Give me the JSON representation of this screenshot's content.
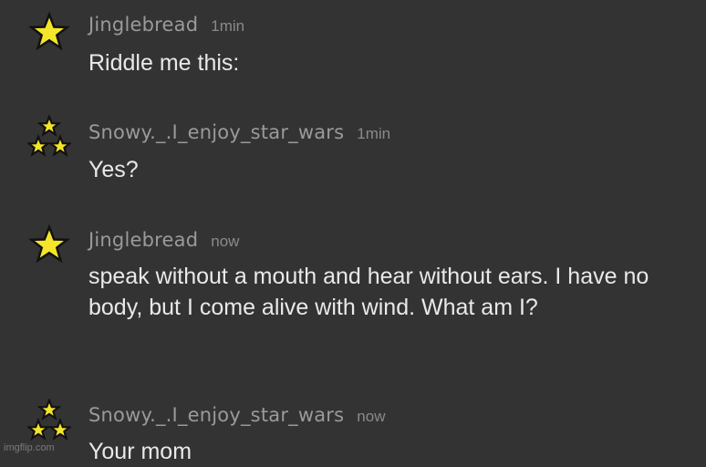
{
  "colors": {
    "background": "#333333",
    "username": "#9a9a9a",
    "timestamp": "#8a8a8a",
    "message_text": "#e9e9e9",
    "star_fill": "#f5e52a",
    "star_outline": "#111111"
  },
  "messages": [
    {
      "avatar_icon": "single-star-icon",
      "username": "Jinglebread",
      "timestamp": "1min",
      "text": "Riddle me this:"
    },
    {
      "avatar_icon": "triple-star-icon",
      "username": "Snowy._.I_enjoy_star_wars",
      "timestamp": "1min",
      "text": "Yes?"
    },
    {
      "avatar_icon": "single-star-icon",
      "username": "Jinglebread",
      "timestamp": "now",
      "text": "speak without a mouth and hear without ears. I have no body, but I come alive with wind. What am I?"
    },
    {
      "avatar_icon": "triple-star-icon",
      "username": "Snowy._.I_enjoy_star_wars",
      "timestamp": "now",
      "text": "Your mom"
    }
  ],
  "watermark": "imgflip.com"
}
